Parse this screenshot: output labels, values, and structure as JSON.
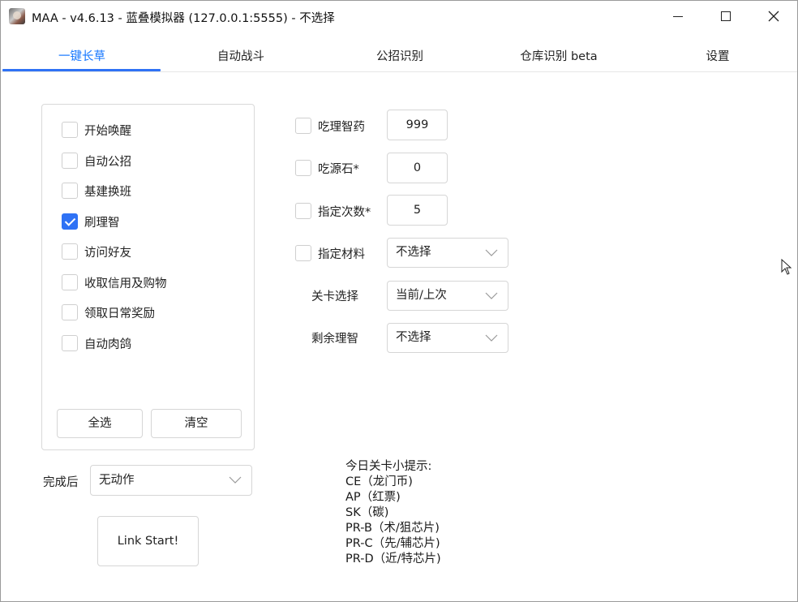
{
  "window": {
    "title": "MAA - v4.6.13 - 蓝叠模拟器 (127.0.0.1:5555) - 不选择"
  },
  "tabs": [
    {
      "label": "一键长草",
      "active": true
    },
    {
      "label": "自动战斗",
      "active": false
    },
    {
      "label": "公招识别",
      "active": false
    },
    {
      "label": "仓库识别 beta",
      "active": false
    },
    {
      "label": "设置",
      "active": false
    }
  ],
  "tasks": [
    {
      "label": "开始唤醒",
      "checked": false
    },
    {
      "label": "自动公招",
      "checked": false
    },
    {
      "label": "基建换班",
      "checked": false
    },
    {
      "label": "刷理智",
      "checked": true
    },
    {
      "label": "访问好友",
      "checked": false
    },
    {
      "label": "收取信用及购物",
      "checked": false
    },
    {
      "label": "领取日常奖励",
      "checked": false
    },
    {
      "label": "自动肉鸽",
      "checked": false
    }
  ],
  "task_buttons": {
    "select_all": "全选",
    "clear": "清空"
  },
  "after_finish": {
    "label": "完成后",
    "value": "无动作"
  },
  "start_button": "Link Start!",
  "settings": {
    "medicine": {
      "label": "吃理智药",
      "checked": false,
      "value": "999"
    },
    "stone": {
      "label": "吃源石*",
      "checked": false,
      "value": "0"
    },
    "times": {
      "label": "指定次数*",
      "checked": false,
      "value": "5"
    },
    "material": {
      "label": "指定材料",
      "checked": false,
      "value": "不选择"
    },
    "stage": {
      "label": "关卡选择",
      "value": "当前/上次"
    },
    "remaining": {
      "label": "剩余理智",
      "value": "不选择"
    }
  },
  "tips": {
    "heading": "今日关卡小提示:",
    "lines": [
      "CE（龙门币)",
      "AP（红票)",
      "SK（碳)",
      "PR-B（术/狙芯片)",
      "PR-C（先/辅芯片)",
      "PR-D（近/特芯片)"
    ]
  },
  "colors": {
    "accent": "#2f72f5",
    "active_tab_text": "#1677ff",
    "border": "#d6d6d6"
  },
  "icons": [
    "app-icon",
    "minimize-icon",
    "maximize-icon",
    "close-icon",
    "chevron-down-icon",
    "checkmark-icon",
    "mouse-pointer-icon"
  ]
}
